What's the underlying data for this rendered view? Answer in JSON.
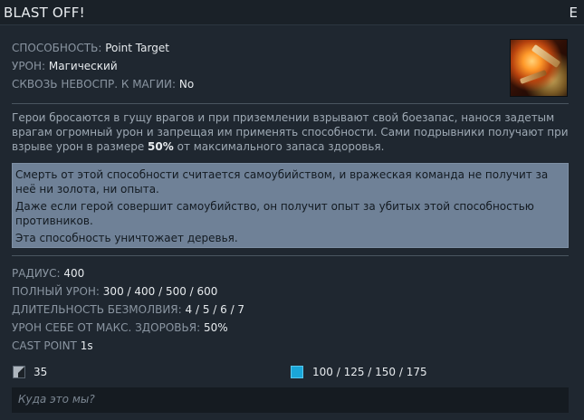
{
  "header": {
    "title": "BLAST OFF!",
    "hotkey": "E"
  },
  "ability": {
    "icon": "blast-off-ability-icon",
    "rows": [
      {
        "label": "СПОСОБНОСТЬ:",
        "value": "Point Target"
      },
      {
        "label": "УРОН:",
        "value": "Магический"
      },
      {
        "label": "СКВОЗЬ НЕВОСПР. К МАГИИ:",
        "value": "No"
      }
    ]
  },
  "description": {
    "part1": "Герои бросаются в гущу врагов и при приземлении взрывают свой боезапас, нанося задетым врагам огромный урон и запрещая им применять способности. Сами подрывники получают при взрыве урон в размере",
    "highlight": "50%",
    "part2": "от максимального запаса здоровья."
  },
  "notes": [
    "Смерть от этой способности считается самоубийством, и вражеская команда не получит за неё ни золота, ни опыта.",
    "Даже если герой совершит самоубийство, он получит опыт за убитых этой способностью противников.",
    "Эта способность уничтожает деревья."
  ],
  "stats": [
    {
      "label": "РАДИУС:",
      "value": "400"
    },
    {
      "label": "ПОЛНЫЙ УРОН:",
      "value": "300 / 400 / 500 / 600"
    },
    {
      "label": "ДЛИТЕЛЬНОСТЬ БЕЗМОЛВИЯ:",
      "value": "4 / 5 / 6 / 7"
    },
    {
      "label": "УРОН СЕБЕ ОТ МАКС. ЗДОРОВЬЯ:",
      "value": "50%"
    },
    {
      "label": "CAST POINT",
      "value": "1s"
    }
  ],
  "costs": {
    "cooldown_icon": "cooldown-icon",
    "cooldown": "35",
    "mana_icon": "mana-icon",
    "mana_color": "#1aa6d8",
    "mana": "100 / 125 / 150 / 175"
  },
  "lore": "Куда это мы?",
  "colors": {
    "background": "#1f2730",
    "note_box": "#6f8197",
    "label": "#8a95a1",
    "value": "#e6eaed"
  }
}
